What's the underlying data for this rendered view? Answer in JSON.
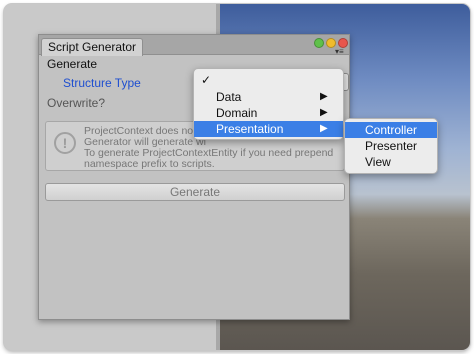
{
  "window": {
    "tab_title": "Script Generator",
    "panel_menu_icon": "panel-menu-icon"
  },
  "form": {
    "section_header": "Generate",
    "structure_label": "Structure Type",
    "overwrite_label": "Overwrite?",
    "help_lines": [
      "ProjectContext does not fo",
      "Generator will generate wi",
      "To generate ProjectContextEntity if you need prepend",
      "namespace prefix to scripts."
    ],
    "generate_label": "Generate"
  },
  "menu": {
    "checked_mark": "✓",
    "items": [
      {
        "label": "Data",
        "has_submenu": true
      },
      {
        "label": "Domain",
        "has_submenu": true
      },
      {
        "label": "Presentation",
        "has_submenu": true,
        "highlighted": true
      }
    ],
    "arrow_glyph": "▶"
  },
  "submenu": {
    "items": [
      {
        "label": "Controller",
        "highlighted": true
      },
      {
        "label": "Presenter"
      },
      {
        "label": "View"
      }
    ]
  },
  "colors": {
    "highlight": "#3b7fe6",
    "label_blue": "#1f4fd0",
    "window_bg": "#c2c2c2"
  }
}
